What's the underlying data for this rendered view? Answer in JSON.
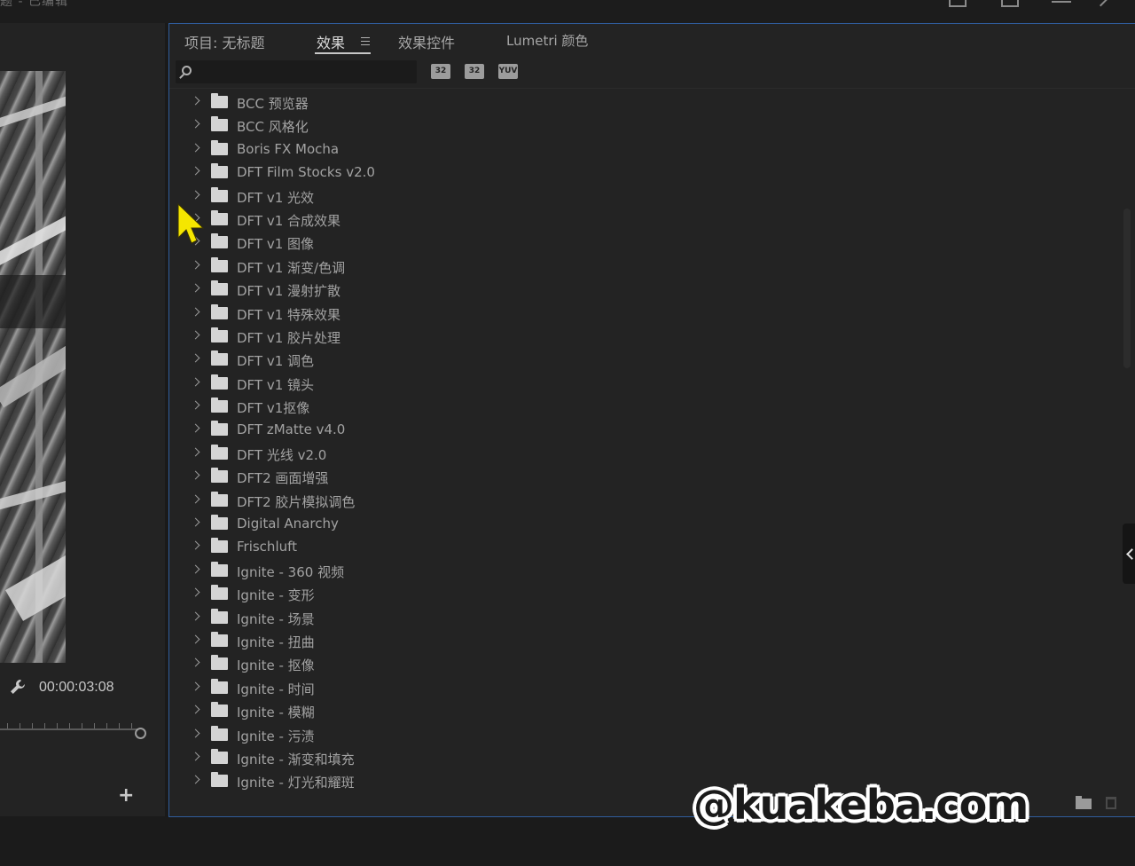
{
  "window": {
    "title_fragment": "题 - 已编辑"
  },
  "program_monitor": {
    "timecode": "00:00:03:08",
    "add_button": "+"
  },
  "effects_panel": {
    "tabs": [
      {
        "label": "项目: 无标题"
      },
      {
        "label": "效果"
      },
      {
        "label": "效果控件"
      },
      {
        "label": "Lumetri 颜色"
      }
    ],
    "search": {
      "value": "",
      "placeholder": ""
    },
    "filter_badges": [
      "32",
      "32",
      "YUV"
    ],
    "items": [
      "BCC 预览器",
      "BCC 风格化",
      "Boris FX Mocha",
      "DFT Film Stocks v2.0",
      "DFT v1 光效",
      "DFT v1 合成效果",
      "DFT v1 图像",
      "DFT v1 渐变/色调",
      "DFT v1 漫射扩散",
      "DFT v1 特殊效果",
      "DFT v1 胶片处理",
      "DFT v1 调色",
      "DFT v1 镜头",
      "DFT v1抠像",
      "DFT zMatte v4.0",
      "DFT 光线 v2.0",
      "DFT2 画面增强",
      "DFT2 胶片模拟调色",
      "Digital Anarchy",
      "Frischluft",
      "Ignite - 360 视频",
      "Ignite - 变形",
      "Ignite - 场景",
      "Ignite - 扭曲",
      "Ignite - 抠像",
      "Ignite - 时间",
      "Ignite - 模糊",
      "Ignite - 污渍",
      "Ignite - 渐变和填充",
      "Ignite - 灯光和耀斑"
    ]
  },
  "watermark": "@kuakeba.com",
  "colors": {
    "accent_border": "#2f5c9c",
    "panel_bg": "#232323",
    "cursor": "#f5e600"
  }
}
